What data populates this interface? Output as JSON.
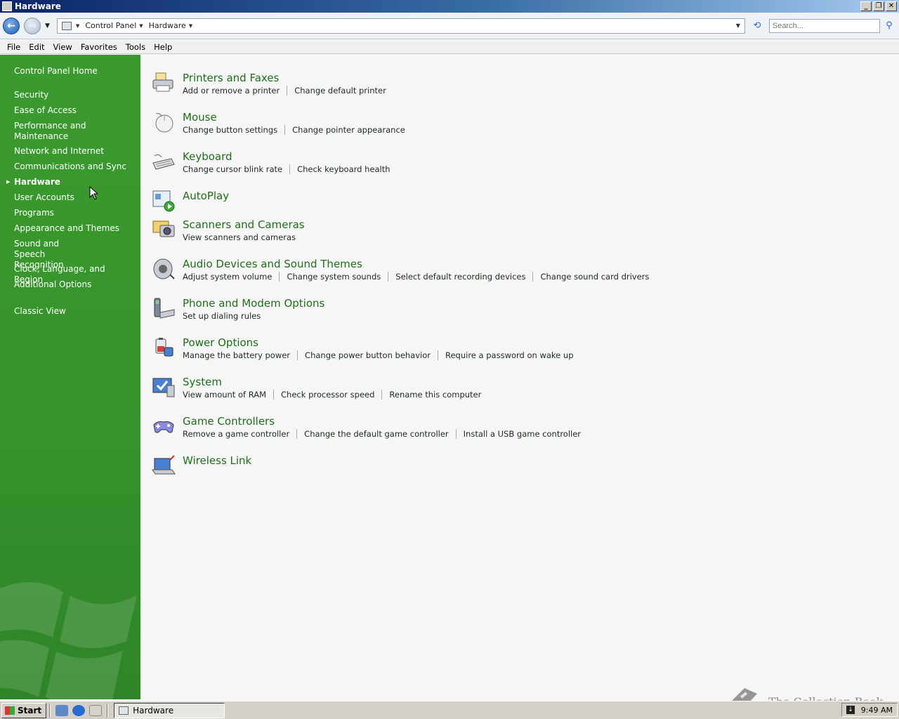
{
  "window": {
    "title": "Hardware"
  },
  "address": {
    "crumbs": [
      "Control Panel",
      "Hardware"
    ],
    "search_placeholder": "Search..."
  },
  "menu": [
    "File",
    "Edit",
    "View",
    "Favorites",
    "Tools",
    "Help"
  ],
  "sidebar": {
    "home": "Control Panel Home",
    "items": [
      "Security",
      "Ease of Access",
      "Performance and Maintenance",
      "Network and Internet",
      "Communications and Sync",
      "Hardware",
      "User Accounts",
      "Programs",
      "Appearance and Themes",
      "Sound and Speech Recognition",
      "Clock, Language, and Region",
      "Additional Options"
    ],
    "current": "Hardware",
    "classic": "Classic View"
  },
  "tasks": [
    {
      "title": "Printers and Faxes",
      "icon": "printer-icon",
      "links": [
        "Add or remove a printer",
        "Change default printer"
      ]
    },
    {
      "title": "Mouse",
      "icon": "mouse-icon",
      "links": [
        "Change button settings",
        "Change pointer appearance"
      ]
    },
    {
      "title": "Keyboard",
      "icon": "keyboard-icon",
      "links": [
        "Change cursor blink rate",
        "Check keyboard health"
      ]
    },
    {
      "title": "AutoPlay",
      "icon": "autoplay-icon",
      "links": []
    },
    {
      "title": "Scanners and Cameras",
      "icon": "scanner-icon",
      "links": [
        "View scanners and cameras"
      ]
    },
    {
      "title": "Audio Devices and Sound Themes",
      "icon": "speaker-icon",
      "links": [
        "Adjust system volume",
        "Change system sounds",
        "Select default recording devices",
        "Change sound card drivers"
      ]
    },
    {
      "title": "Phone and Modem Options",
      "icon": "phone-icon",
      "links": [
        "Set up dialing rules"
      ]
    },
    {
      "title": "Power Options",
      "icon": "power-icon",
      "links": [
        "Manage the battery power",
        "Change power button behavior",
        "Require a password on wake up"
      ]
    },
    {
      "title": "System",
      "icon": "system-icon",
      "links": [
        "View amount of RAM",
        "Check processor speed",
        "Rename this computer"
      ]
    },
    {
      "title": "Game Controllers",
      "icon": "gamepad-icon",
      "links": [
        "Remove a game controller",
        "Change the default game controller",
        "Install a USB game controller"
      ]
    },
    {
      "title": "Wireless Link",
      "icon": "wireless-icon",
      "links": []
    }
  ],
  "taskbar": {
    "start": "Start",
    "active_window": "Hardware",
    "clock": "9:49 AM"
  },
  "watermark": "The Collection Book",
  "colors": {
    "sidebar_green": "#36922c",
    "task_title_green": "#1e6e1a",
    "titlebar_blue": "#0a246a"
  }
}
